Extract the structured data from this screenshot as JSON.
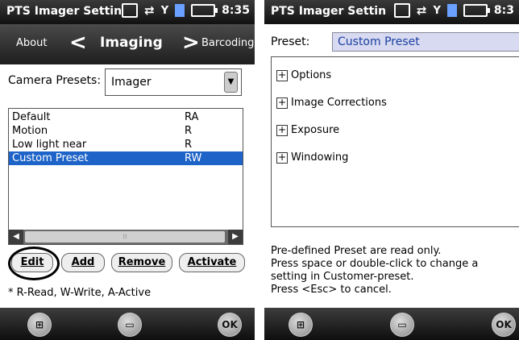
{
  "left": {
    "status": {
      "title": "PTS Imager Settin",
      "time": "8:35"
    },
    "nav": {
      "prev": "About",
      "current": "Imaging",
      "next": "Barcoding"
    },
    "camera_presets": {
      "label": "Camera Presets:",
      "value": "Imager"
    },
    "presets": [
      {
        "name": "Default",
        "access": "RA"
      },
      {
        "name": "Motion",
        "access": "R"
      },
      {
        "name": "Low light near",
        "access": "R"
      },
      {
        "name": "Custom Preset",
        "access": "RW"
      }
    ],
    "selected_index": 3,
    "buttons": {
      "edit": "Edit",
      "add": "Add",
      "remove": "Remove",
      "activate": "Activate"
    },
    "legend": "* R-Read, W-Write, A-Active",
    "bottom": {
      "ok": "OK"
    }
  },
  "right": {
    "status": {
      "title": "PTS Imager Settin",
      "time": "8:3"
    },
    "preset": {
      "label": "Preset:",
      "value": "Custom Preset"
    },
    "tree": [
      "Options",
      "Image Corrections",
      "Exposure",
      "Windowing"
    ],
    "info": [
      "Pre-defined Preset are read only.",
      "Press space or double-click to change a",
      "setting in Customer-preset.",
      "Press <Esc> to cancel."
    ],
    "bottom": {
      "ok": "OK"
    }
  },
  "colors": {
    "selection": "#1e64c8",
    "preset_field_bg": "#d7daf0",
    "bar_dark": "#1e1e1e"
  }
}
